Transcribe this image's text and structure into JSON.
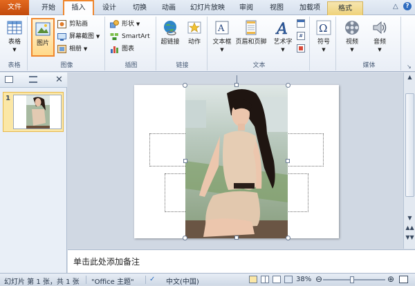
{
  "ribbon_tabs": {
    "file": "文件",
    "home": "开始",
    "insert": "插入",
    "design": "设计",
    "transitions": "切换",
    "animations": "动画",
    "slideshow": "幻灯片放映",
    "review": "审阅",
    "view": "视图",
    "addins": "加载项",
    "format": "格式"
  },
  "ribbon": {
    "table_group": {
      "table": "表格",
      "label": "表格"
    },
    "image_group": {
      "picture": "图片",
      "clipart": "剪贴画",
      "screenshot": "屏幕截图",
      "album": "相册",
      "label": "图像"
    },
    "illustration_group": {
      "shapes": "形状",
      "smartart": "SmartArt",
      "chart": "图表",
      "label": "插图"
    },
    "link_group": {
      "hyperlink": "超链接",
      "action": "动作",
      "label": "链接"
    },
    "text_group": {
      "textbox": "文本框",
      "header_footer": "页眉和页脚",
      "wordart": "艺术字",
      "label": "文本"
    },
    "symbol_group": {
      "symbol": "符号"
    },
    "media_group": {
      "video": "视频",
      "audio": "音频",
      "label": "媒体"
    }
  },
  "thumbnails": [
    {
      "number": "1"
    }
  ],
  "notes_placeholder": "单击此处添加备注",
  "statusbar": {
    "slide_info": "幻灯片 第 1 张，共 1 张",
    "theme": "\"Office 主题\"",
    "language": "中文(中国)",
    "zoom": "38%",
    "zoom_level": 0.38
  },
  "colors": {
    "accent_orange": "#f0862c",
    "file_tab": "#d4571a",
    "format_tab": "#efd27a"
  }
}
